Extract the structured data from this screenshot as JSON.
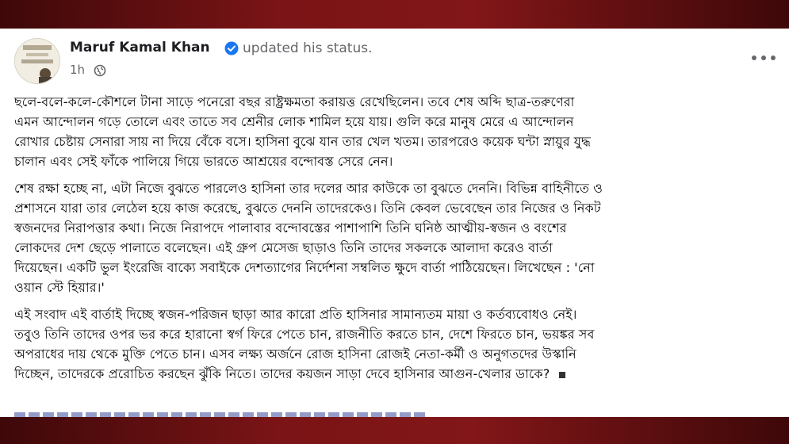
{
  "post": {
    "author": "Maruf Kamal Khan",
    "action": "updated his status.",
    "time": "1h",
    "avatar_icon": "profile-avatar",
    "verified_icon": "verified-badge-icon",
    "privacy_icon": "globe-icon",
    "more_icon": "more-options-icon",
    "colors": {
      "verified": "#1877f2",
      "frame": "#7a1416"
    },
    "paragraphs": [
      "ছলে-বলে-কলে-কৌশলে টানা সাড়ে পনেরো বছর রাষ্ট্রক্ষমতা করায়ত্ত রেখেছিলেন। তবে শেষ অব্দি ছাত্র-তরুণেরা\nএমন আন্দোলন গড়ে তোলে এবং তাতে সব শ্রেনীর লোক শামিল হয়ে যায়। গুলি করে মানুষ মেরে এ আন্দোলন\nরোখার চেষ্টায় সেনারা সায় না দিয়ে বেঁকে বসে। হাসিনা বুঝে যান তার খেল খতম। তারপরেও কয়েক ঘন্টা স্নায়ুর যুদ্ধ\nচালান এবং সেই ফাঁকে পালিয়ে গিয়ে ভারতে আশ্রয়ের বন্দোবস্ত সেরে নেন।",
      "শেষ রক্ষা হচ্ছে না, এটা নিজে বুঝতে পারলেও হাসিনা তার দলের আর কাউকে তা বুঝতে দেননি। বিভিন্ন বাহিনীতে ও\nপ্রশাসনে যারা তার লেঠেল হয়ে কাজ করেছে, বুঝতে দেননি তাদেরকেও। তিনি কেবল ভেবেছেন তার নিজের ও নিকট\nস্বজনদের নিরাপত্তার কথা। নিজে নিরাপদে পালাবার বন্দোবস্তের পাশাপাশি তিনি ঘনিষ্ঠ আত্মীয়-স্বজন ও বংশের\nলোকদের দেশ ছেড়ে পালাতে বলেছেন। এই গ্রুপ মেসেজ ছাড়াও তিনি তাদের সকলকে আলাদা করেও বার্তা\nদিয়েছেন। একটি ভুল ইংরেজি বাক্যে সবাইকে দেশত্যাগের নির্দেশনা সম্বলিত ক্ষুদে বার্তা পাঠিয়েছেন। লিখেছেন : 'নো\nওয়ান স্টে হিয়ার।'",
      "এই সংবাদ এই বার্তাই দিচ্ছে স্বজন-পরিজন ছাড়া আর কারো প্রতি হাসিনার সামান্যতম মায়া ও কর্তব্যবোধও নেই।\nতবুও তিনি তাদের ওপর ভর করে হারানো স্বর্গ ফিরে পেতে চান, রাজনীতি করতে চান, দেশে ফিরতে চান, ভয়ঙ্কর সব\nঅপরাধের দায় থেকে মুক্তি পেতে চান। এসব লক্ষ্য অর্জনে রোজ হাসিনা রোজই নেতা-কর্মী ও অনুগতদের উস্কানি\nদিচ্ছেন, তাদেরকে প্ররোচিত করছেন ঝুঁকি নিতে। তাদের কয়জন সাড়া দেবে হাসিনার আগুন-খেলার ডাকে?"
    ]
  }
}
